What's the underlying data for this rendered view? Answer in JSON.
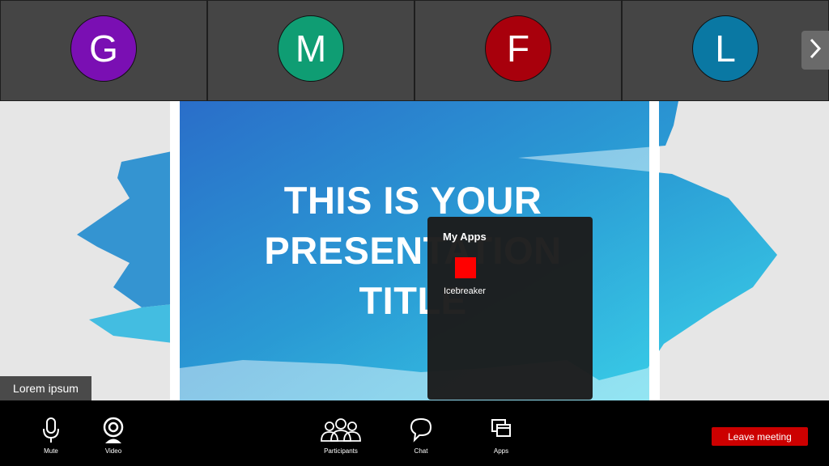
{
  "participants": [
    {
      "initial": "G",
      "color": "#7a0fb3"
    },
    {
      "initial": "M",
      "color": "#0f9d73"
    },
    {
      "initial": "F",
      "color": "#a8000c"
    },
    {
      "initial": "L",
      "color": "#0a78a3"
    }
  ],
  "strip": {
    "next_icon": "chevron-right-icon"
  },
  "slide": {
    "title": "THIS IS YOUR\nPRESENTATION\nTITLE"
  },
  "speaker": {
    "name": "Lorem ipsum"
  },
  "apps_panel": {
    "title": "My Apps",
    "apps": [
      {
        "label": "Icebreaker",
        "color": "#ff0000"
      }
    ]
  },
  "toolbar": {
    "mute": {
      "label": "Mute",
      "icon": "microphone-icon"
    },
    "video": {
      "label": "Video",
      "icon": "camera-icon"
    },
    "participants": {
      "label": "Participants",
      "icon": "people-icon"
    },
    "chat": {
      "label": "Chat",
      "icon": "chat-bubble-icon"
    },
    "apps": {
      "label": "Apps",
      "icon": "windows-icon"
    },
    "leave": {
      "label": "Leave meeting",
      "color": "#cc0000"
    }
  }
}
